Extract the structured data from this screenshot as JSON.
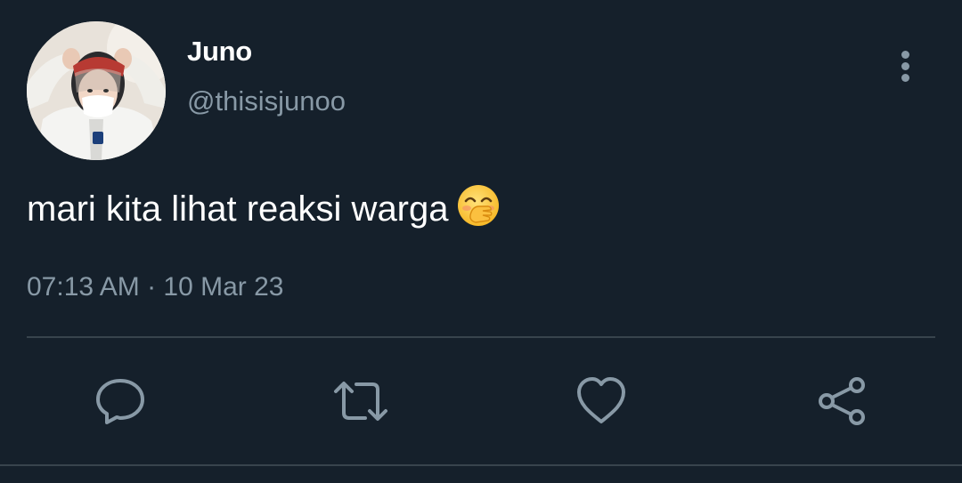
{
  "tweet": {
    "author": {
      "display_name": "Juno",
      "handle": "@thisisjunoo",
      "avatar_icon": "profile-photo"
    },
    "text": "mari kita lihat reaksi warga",
    "emoji": "face-with-hand-over-mouth",
    "timestamp": "07:13 AM · 10 Mar 23"
  },
  "actions": [
    {
      "name": "reply",
      "icon": "speech-bubble-icon"
    },
    {
      "name": "retweet",
      "icon": "retweet-icon"
    },
    {
      "name": "like",
      "icon": "heart-icon"
    },
    {
      "name": "share",
      "icon": "share-icon"
    }
  ],
  "colors": {
    "background": "#15202b",
    "primary_text": "#ffffff",
    "secondary_text": "#8899a6",
    "divider": "#38444d"
  }
}
